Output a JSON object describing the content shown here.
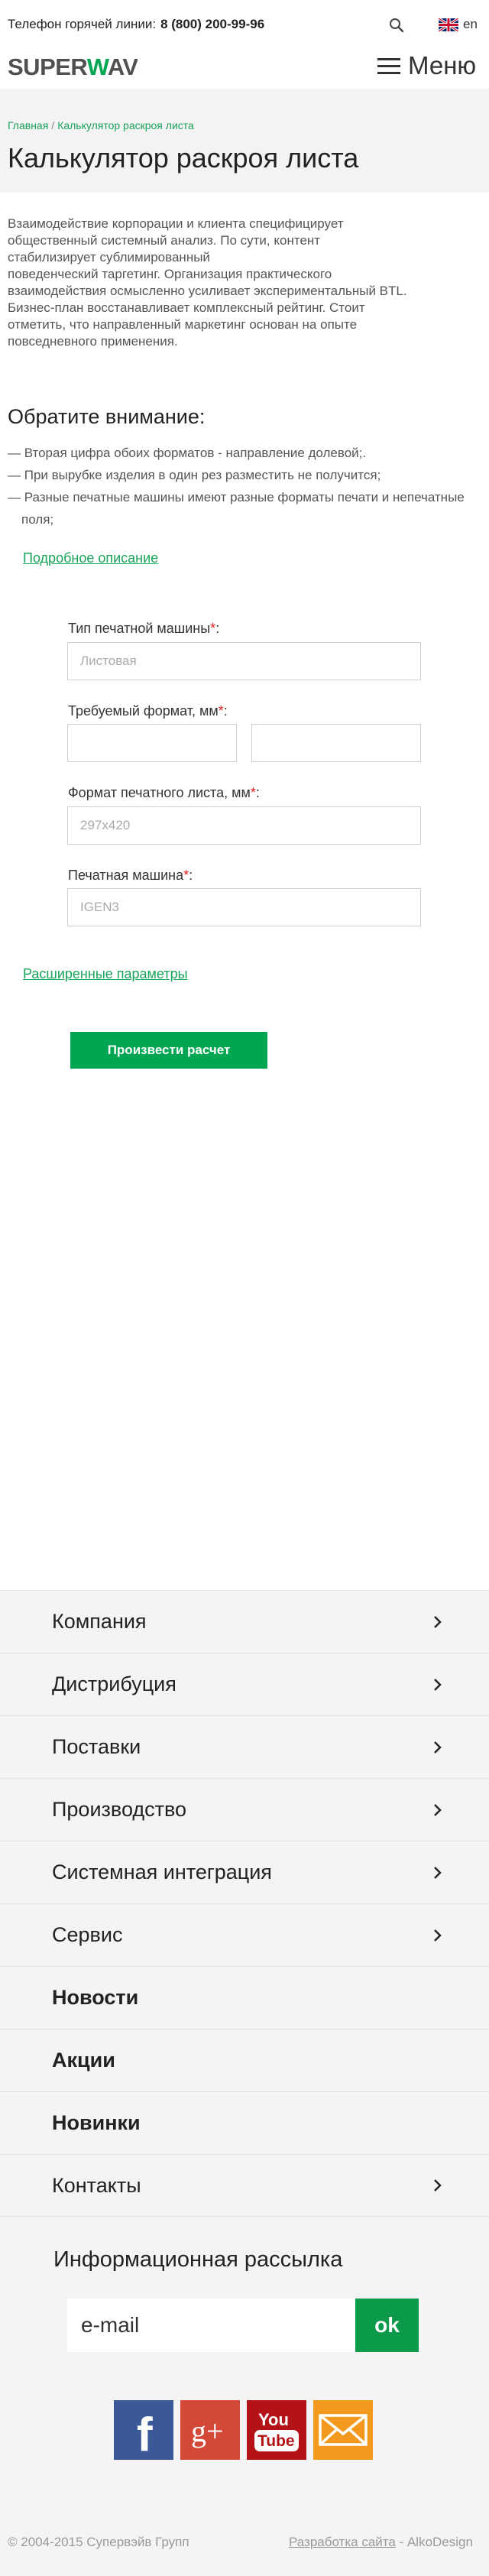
{
  "header": {
    "hotline_label": "Телефон горячей линии:",
    "hotline_phone": "8 (800) 200-99-96",
    "lang": "en",
    "logo": "SUPERWAVE",
    "menu_label": "Меню"
  },
  "breadcrumb": {
    "home": "Главная",
    "separator": "/",
    "current": "Калькулятор раскроя листа"
  },
  "page_title": "Калькулятор раскроя листа",
  "intro": {
    "lines": [
      "Взаимодействие корпорации и клиента специфицирует",
      "общественный системный анализ. По сути, контент",
      "стабилизирует сублимированный",
      "поведенческий таргетинг. Организация практического",
      "взаимодействия осмысленно усиливает экспериментальный BTL.",
      "Бизнес-план восстанавливает комплексный рейтинг. Стоит",
      "отметить, что направленный маркетинг основан на опыте",
      "повседневного применения."
    ]
  },
  "attention": {
    "title": "Обратите внимание:",
    "notes": [
      "— Вторая цифра обоих форматов - направление долевой;.",
      "— При вырубке изделия в один рез разместить не получится;",
      "— Разные печатные машины имеют разные форматы печати и непечатные поля;"
    ],
    "more_link": "Подробное описание"
  },
  "form": {
    "required_mark": "*",
    "machine_type_label": "Тип печатной машины",
    "machine_type_placeholder": "Листовая",
    "format_label": "Требуемый формат, мм",
    "format_width_value": "",
    "format_height_value": "",
    "sheet_format_label": "Формат печатного листа, мм",
    "sheet_format_placeholder": "297x420",
    "machine_label": "Печатная машина",
    "machine_placeholder": "IGEN3",
    "advanced_link": "Расширенные параметры",
    "submit_label": "Произвести расчет"
  },
  "footer_nav": [
    {
      "label": "Компания",
      "has_arrow": true
    },
    {
      "label": "Дистрибуция",
      "has_arrow": true
    },
    {
      "label": "Поставки",
      "has_arrow": true
    },
    {
      "label": "Производство",
      "has_arrow": true
    },
    {
      "label": "Системная интеграция",
      "has_arrow": true
    },
    {
      "label": "Сервис",
      "has_arrow": true
    },
    {
      "label": "Новости",
      "has_arrow": false
    },
    {
      "label": "Акции",
      "has_arrow": false
    },
    {
      "label": "Новинки",
      "has_arrow": false
    },
    {
      "label": "Контакты",
      "has_arrow": true
    }
  ],
  "newsletter": {
    "title": "Информационная рассылка",
    "email_placeholder": "e-mail",
    "ok_label": "ok"
  },
  "social": {
    "facebook": {
      "icon": "facebook-icon",
      "glyph": "f",
      "color": "#3b5998"
    },
    "googleplus": {
      "icon": "google-plus-icon",
      "glyph": "g+",
      "color": "#d34836"
    },
    "youtube": {
      "icon": "youtube-icon",
      "glyph_top": "You",
      "glyph_bottom": "Tube",
      "color": "#b31217"
    },
    "mail": {
      "icon": "mail-icon",
      "color": "#f39a1e"
    }
  },
  "copyright": "© 2004-2015 Супервэйв Групп",
  "developer": {
    "link": "Разработка сайта",
    "separator": " - ",
    "name": "AlkoDesign"
  },
  "colors": {
    "accent": "#00a651",
    "link": "#1aa35a",
    "required": "#e02020"
  }
}
